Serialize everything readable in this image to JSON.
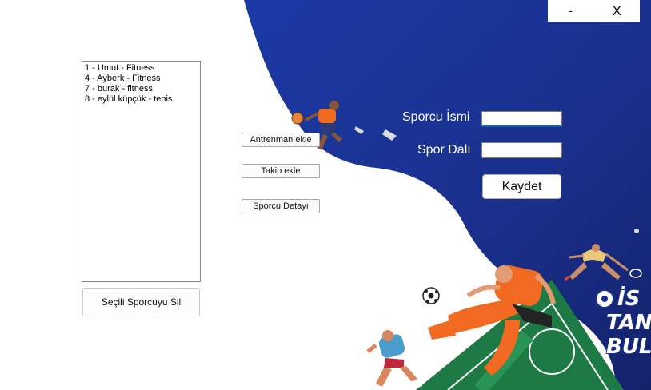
{
  "window": {
    "minimize_label": "-",
    "close_label": "X"
  },
  "athletes": {
    "items": [
      "1 - Umut - Fitness",
      "4 - Ayberk - Fitness",
      "7 - burak - fitness",
      "8 - eylül küpçük - tenis"
    ]
  },
  "actions": {
    "delete_label": "Seçili Sporcuyu Sil",
    "add_training_label": "Antrenman ekle",
    "add_follow_label": "Takip ekle",
    "athlete_detail_label": "Sporcu Detayı"
  },
  "form": {
    "name_label": "Sporcu İsmi",
    "name_value": "",
    "sport_label": "Spor Dalı",
    "sport_value": "",
    "save_label": "Kaydet"
  },
  "logo": {
    "line1": "İS",
    "line2": "TAN",
    "line3": "BUL"
  },
  "colors": {
    "brand_blue": "#1a2f8a",
    "accent_orange": "#f26a21",
    "field_green": "#1e7a45"
  }
}
